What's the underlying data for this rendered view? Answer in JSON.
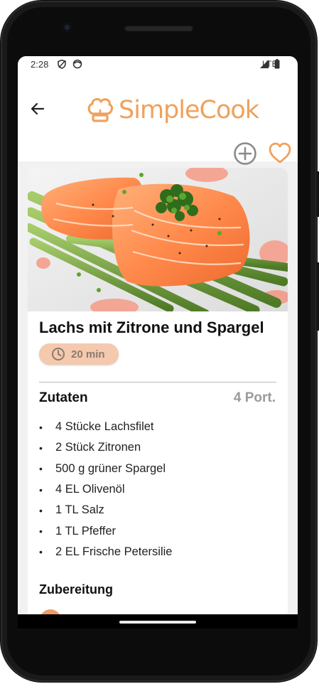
{
  "status_bar": {
    "time": "2:28",
    "network": "LTE"
  },
  "app_bar": {
    "logo_text": "SimpleCook"
  },
  "recipe": {
    "title": "Lachs mit Zitrone und Spargel",
    "time": "20 min",
    "ingredients_heading": "Zutaten",
    "portions": "4 Port.",
    "ingredients": [
      "4 Stücke Lachsfilet",
      "2 Stück Zitronen",
      "500 g grüner Spargel",
      "4 EL Olivenöl",
      "1 TL Salz",
      "1 TL Pfeffer",
      "2 EL Frische Petersilie"
    ],
    "preparation_heading": "Zubereitung"
  },
  "colors": {
    "accent": "#f0a15c",
    "chip": "#f5c9ad",
    "icon_grey": "#8a8a8a"
  },
  "icons": [
    "back-arrow-icon",
    "chef-hat-icon",
    "add-circle-icon",
    "heart-icon",
    "clock-icon",
    "shield-icon",
    "face-icon",
    "signal-icon",
    "battery-icon"
  ]
}
